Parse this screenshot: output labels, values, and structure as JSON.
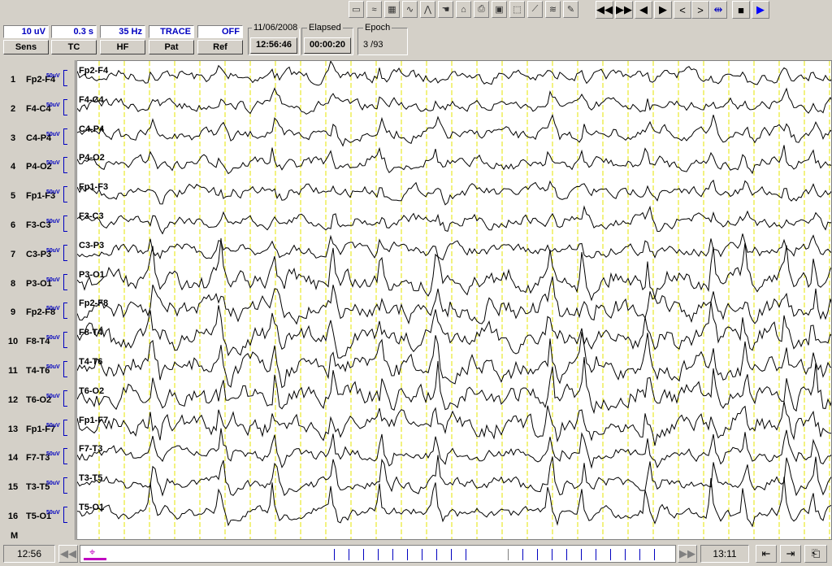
{
  "toolbar": {
    "icons": [
      "save-icon",
      "montage-icon",
      "grid-icon",
      "waveform-icon",
      "spike-icon",
      "hand-icon",
      "event-icon",
      "print-icon",
      "display-icon",
      "select-icon",
      "ruler-icon",
      "video-icon",
      "notes-icon"
    ],
    "glyphs": [
      "▭",
      "≈",
      "▦",
      "∿",
      "⋀",
      "☚",
      "⌂",
      "⎙",
      "▣",
      "⬚",
      "⟋",
      "≋",
      "✎"
    ],
    "nav": [
      {
        "name": "fast-rewind-button",
        "glyph": "◀◀"
      },
      {
        "name": "fast-forward-button",
        "glyph": "▶▶"
      },
      {
        "name": "page-back-button",
        "glyph": "◀"
      },
      {
        "name": "page-forward-button",
        "glyph": "▶"
      },
      {
        "name": "step-back-button",
        "glyph": "<"
      },
      {
        "name": "step-forward-button",
        "glyph": ">"
      },
      {
        "name": "cursor-button",
        "glyph": "⇹"
      },
      {
        "name": "stop-button",
        "glyph": "■"
      },
      {
        "name": "play-button",
        "glyph": "▶"
      }
    ]
  },
  "settings": [
    {
      "key": "sens",
      "value": "10 uV",
      "label": "Sens"
    },
    {
      "key": "tc",
      "value": "0.3 s",
      "label": "TC"
    },
    {
      "key": "hf",
      "value": "35 Hz",
      "label": "HF"
    },
    {
      "key": "pat",
      "value": "TRACE",
      "label": "Pat"
    },
    {
      "key": "ref",
      "value": "OFF",
      "label": "Ref"
    }
  ],
  "date": "11/06/2008",
  "clock": "12:56:46",
  "elapsed": {
    "title": "Elapsed",
    "value": "00:00:20"
  },
  "epoch": {
    "title": "Epoch",
    "value": "3 /93"
  },
  "channels": [
    {
      "num": "1",
      "name": "Fp2-F4"
    },
    {
      "num": "2",
      "name": "F4-C4"
    },
    {
      "num": "3",
      "name": "C4-P4"
    },
    {
      "num": "4",
      "name": "P4-O2"
    },
    {
      "num": "5",
      "name": "Fp1-F3"
    },
    {
      "num": "6",
      "name": "F3-C3"
    },
    {
      "num": "7",
      "name": "C3-P3"
    },
    {
      "num": "8",
      "name": "P3-O1"
    },
    {
      "num": "9",
      "name": "Fp2-F8"
    },
    {
      "num": "10",
      "name": "F8-T4"
    },
    {
      "num": "11",
      "name": "T4-T6"
    },
    {
      "num": "12",
      "name": "T6-O2"
    },
    {
      "num": "13",
      "name": "Fp1-F7"
    },
    {
      "num": "14",
      "name": "F7-T3"
    },
    {
      "num": "15",
      "name": "T3-T5"
    },
    {
      "num": "16",
      "name": "T5-O1"
    }
  ],
  "scale_label": "50uV",
  "m_label": "M",
  "bottom": {
    "start_time": "12:56",
    "end_time": "13:11",
    "rewind_glyph": "◀◀",
    "forward_glyph": "▶▶",
    "left_glyph": "⇤",
    "right_glyph": "⇥",
    "extra_glyph": "⎗",
    "marker_glyph": "⌖"
  },
  "colors": {
    "trace": "#000000",
    "gridline": "#e6e600",
    "accent": "#0000c0",
    "marker": "#c000c0"
  }
}
